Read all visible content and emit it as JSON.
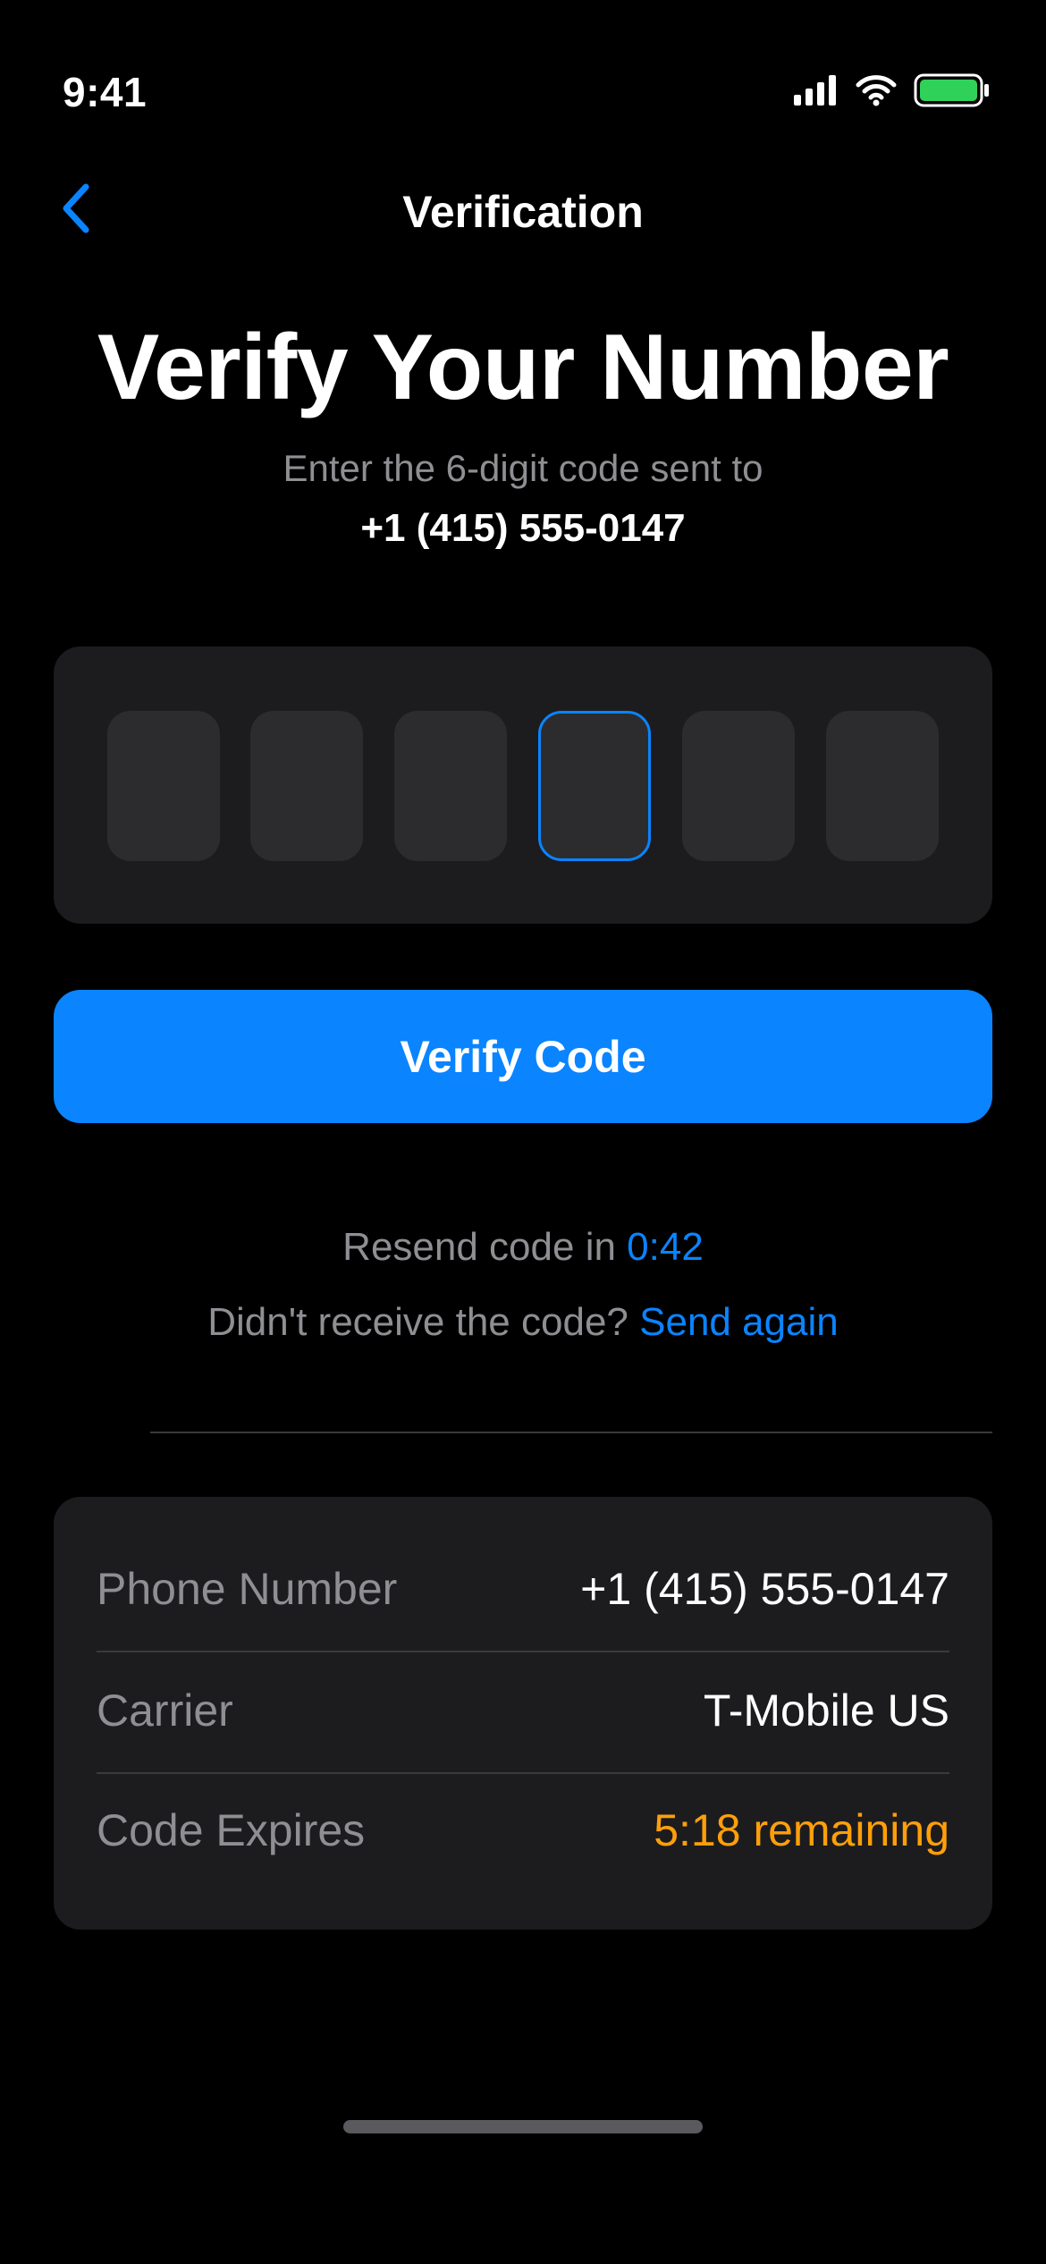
{
  "status_bar": {
    "time": "9:41",
    "icons": [
      "cellular-signal-icon",
      "wifi-icon",
      "battery-icon"
    ],
    "battery_color": "#30d158"
  },
  "nav": {
    "back_icon": "chevron-left-icon",
    "title": "Verification"
  },
  "header": {
    "headline": "Verify Your Number",
    "subtitle": "Enter the 6-digit code sent to",
    "phone": "+1 (415) 555-0147"
  },
  "code_input": {
    "digit_count": 6,
    "active_index": 3,
    "digits": [
      "",
      "",
      "",
      "",
      "",
      ""
    ]
  },
  "actions": {
    "verify_label": "Verify Code"
  },
  "resend": {
    "prefix": "Resend code in",
    "timer": "0:42",
    "question": "Didn't receive the code?",
    "link": "Send again"
  },
  "details": {
    "rows": [
      {
        "label": "Phone Number",
        "value": "+1 (415) 555-0147"
      },
      {
        "label": "Carrier",
        "value": "T-Mobile US"
      },
      {
        "label": "Code Expires",
        "value": "5:18 remaining"
      }
    ]
  },
  "colors": {
    "accent": "#0a84ff",
    "warning": "#ff9f0a",
    "background": "#000000",
    "card": "#1c1c1e"
  }
}
